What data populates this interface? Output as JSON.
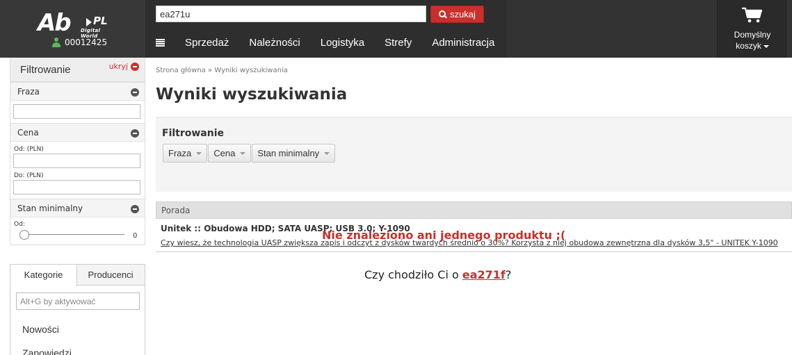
{
  "header": {
    "logo": {
      "mark": "Ab",
      "suffix": "PL",
      "tagline": "Digital World"
    },
    "client_id": "00012425",
    "search": {
      "value": "ea271u",
      "button_label": "szukaj"
    },
    "nav": [
      "Sprzedaż",
      "Należności",
      "Logistyka",
      "Strefy",
      "Administracja"
    ],
    "cart": {
      "line1": "Domyślny",
      "line2": "koszyk"
    }
  },
  "sidebar": {
    "title": "Filtrowanie",
    "hide_label": "ukryj",
    "phrase": {
      "title": "Fraza",
      "value": ""
    },
    "price": {
      "title": "Cena",
      "from_label": "Od: (PLN)",
      "to_label": "Do: (PLN)",
      "from_value": "",
      "to_value": ""
    },
    "min_stock": {
      "title": "Stan minimalny",
      "from_label": "Od:",
      "value": "0"
    },
    "tabs": [
      "Kategorie",
      "Producenci"
    ],
    "category_search_placeholder": "Alt+G by aktywować",
    "categories": [
      "Nowości",
      "Zapowiedzi"
    ]
  },
  "main": {
    "breadcrumb": "Strona główna » Wyniki wyszukiwania",
    "title": "Wyniki wyszukiwania",
    "filter_panel": {
      "title": "Filtrowanie",
      "dropdowns": [
        "Fraza",
        "Cena",
        "Stan minimalny"
      ]
    },
    "tip": {
      "header": "Porada",
      "title": "Unitek :: Obudowa HDD; SATA UASP; USB 3.0; Y-1090",
      "text": "Czy wiesz, że technologia UASP zwiększa zapis i odczyt z dysków twardych średnio o 30%? Korzysta z niej obudowa zewnętrzna dla dysków 3,5\" - UNITEK Y-1090"
    },
    "not_found": "Nie znaleziono ani jednego produktu ;(",
    "did_you_mean": {
      "prefix": "Czy chodziło Ci o ",
      "suggestion": "ea271f",
      "suffix": "?"
    }
  },
  "colors": {
    "header_bg": "#333333",
    "accent_red": "#c9302c",
    "user_icon": "#5cb85c"
  }
}
